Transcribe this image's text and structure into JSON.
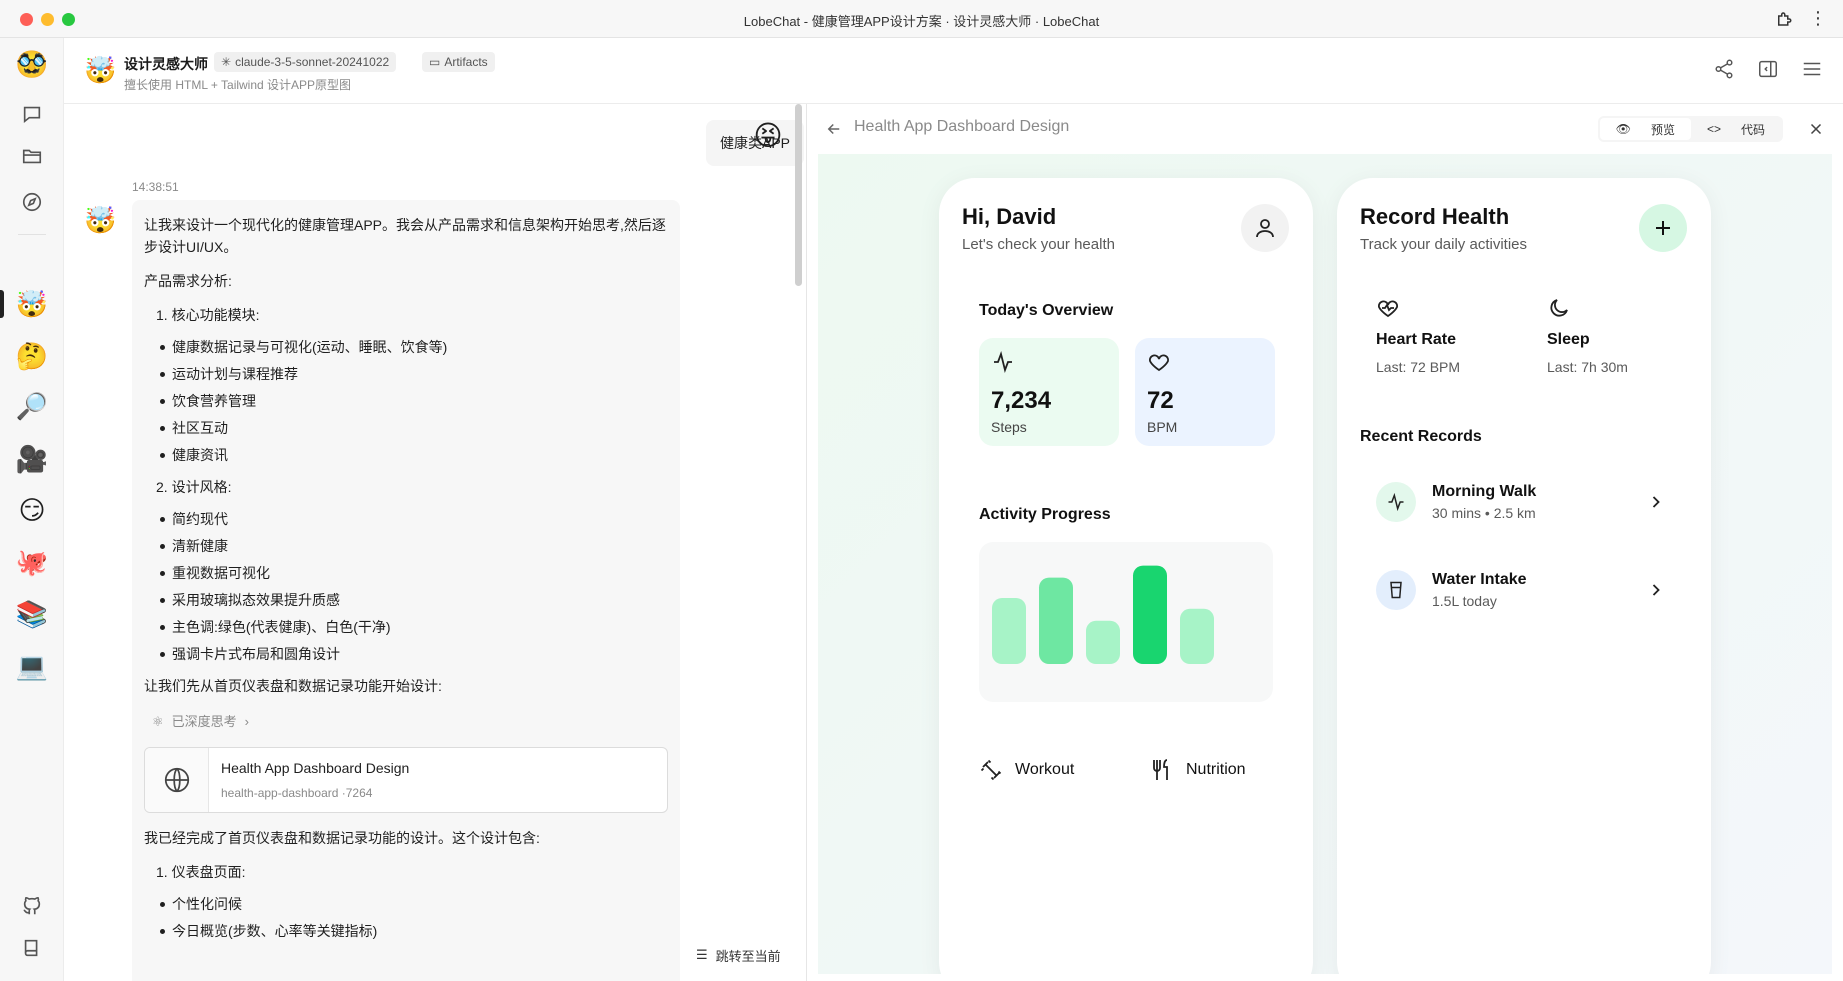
{
  "window": {
    "title": "LobeChat - 健康管理APP设计方案 · 设计灵感大师 · LobeChat"
  },
  "rail": {
    "agents": [
      "🥸",
      "🤯",
      "🤔",
      "🔎",
      "🎥",
      "😏",
      "🐙",
      "📚",
      "💻"
    ]
  },
  "chat_header": {
    "avatar": "🤯",
    "name": "设计灵感大师",
    "description": "擅长使用 HTML + Tailwind 设计APP原型图",
    "model_tag": "claude-3-5-sonnet-20241022",
    "artifacts_tag": "Artifacts"
  },
  "chat": {
    "user_message": "健康类APP",
    "user_avatar": "😝",
    "bot_avatar": "🤯",
    "time": "14:38:51",
    "intro": "让我来设计一个现代化的健康管理APP。我会从产品需求和信息架构开始思考,然后逐步设计UI/UX。",
    "analysis_title": "产品需求分析:",
    "section1": "1. 核心功能模块:",
    "section1_items": [
      "健康数据记录与可视化(运动、睡眠、饮食等)",
      "运动计划与课程推荐",
      "饮食营养管理",
      "社区互动",
      "健康资讯"
    ],
    "section2": "2. 设计风格:",
    "section2_items": [
      "简约现代",
      "清新健康",
      "重视数据可视化",
      "采用玻璃拟态效果提升质感",
      "主色调:绿色(代表健康)、白色(干净)",
      "强调卡片式布局和圆角设计"
    ],
    "lead_in": "让我们先从首页仪表盘和数据记录功能开始设计:",
    "thinking": "已深度思考",
    "artifact_title": "Health App Dashboard Design",
    "artifact_sub": "health-app-dashboard ·7264",
    "done": "我已经完成了首页仪表盘和数据记录功能的设计。这个设计包含:",
    "section3": "1. 仪表盘页面:",
    "section3_items": [
      "个性化问候",
      "今日概览(步数、心率等关键指标)"
    ],
    "jump_label": "跳转至当前"
  },
  "panel": {
    "title": "Health App Dashboard Design",
    "preview_label": "预览",
    "code_label": "代码"
  },
  "dashboard": {
    "greeting": "Hi, David",
    "subtitle": "Let's check your health",
    "overview_title": "Today's Overview",
    "steps_value": "7,234",
    "steps_unit": "Steps",
    "bpm_value": "72",
    "bpm_unit": "BPM",
    "activity_title": "Activity Progress",
    "workout_label": "Workout",
    "nutrition_label": "Nutrition"
  },
  "chart_data": {
    "type": "bar",
    "values": [
      0.55,
      0.72,
      0.36,
      0.82,
      0.46
    ],
    "colors": [
      "#a7f3c7",
      "#6ee7a2",
      "#a7f3c7",
      "#19d56f",
      "#a7f3c7"
    ],
    "ylim": [
      0,
      1
    ]
  },
  "record": {
    "title": "Record Health",
    "subtitle": "Track your daily activities",
    "heart_title": "Heart Rate",
    "heart_last": "Last: 72 BPM",
    "sleep_title": "Sleep",
    "sleep_last": "Last: 7h 30m",
    "recent_title": "Recent Records",
    "walk_title": "Morning Walk",
    "walk_sub": "30 mins • 2.5 km",
    "water_title": "Water Intake",
    "water_sub": "1.5L today"
  },
  "colors": {
    "accent_green": "#19d56f",
    "light_green": "#a7f3c7"
  }
}
